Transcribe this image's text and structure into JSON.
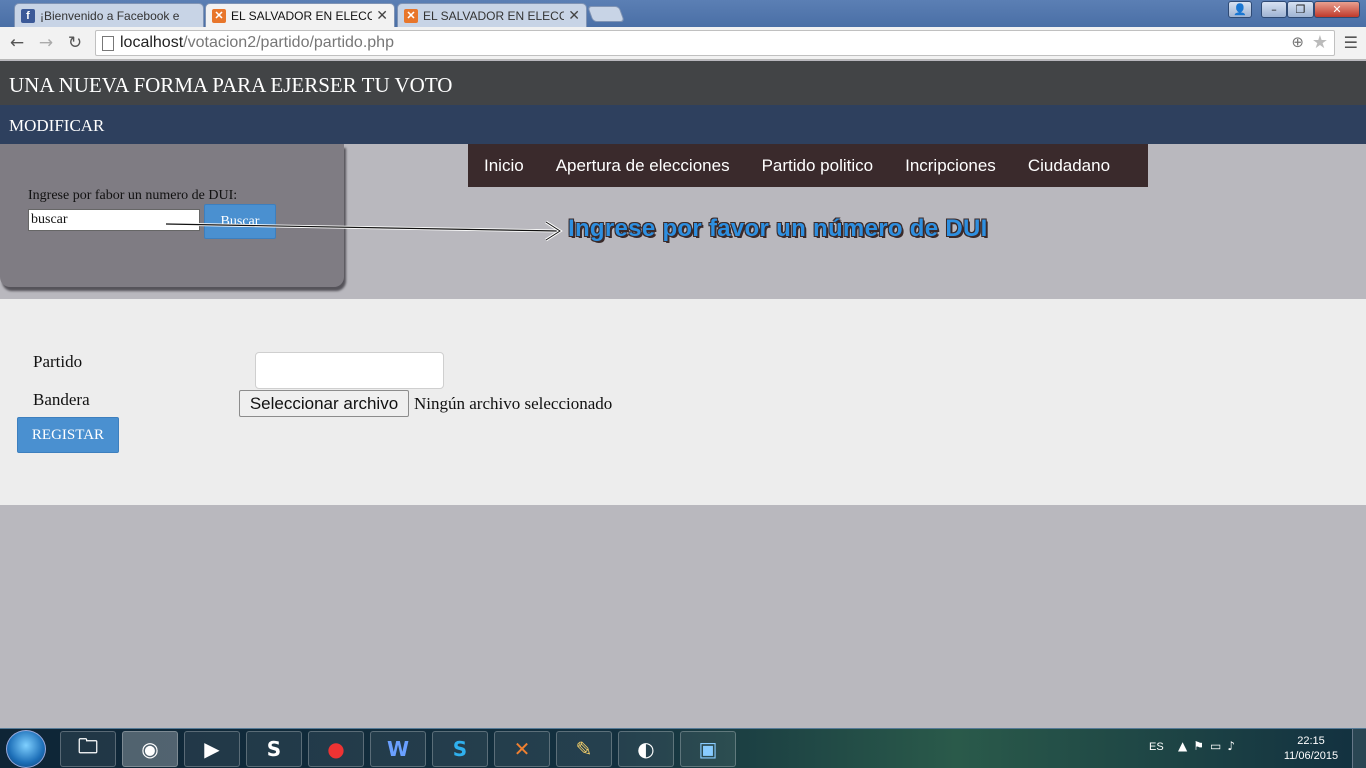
{
  "browser": {
    "tabs": [
      {
        "label": "¡Bienvenido a Facebook e",
        "favicon": "facebook-icon",
        "active": false
      },
      {
        "label": "EL SALVADOR EN ELECCIO",
        "favicon": "xampp-icon",
        "active": true
      },
      {
        "label": "EL SALVADOR EN ELECCIO",
        "favicon": "xampp-icon",
        "active": false
      }
    ],
    "url_host": "localhost",
    "url_path": "/votacion2/partido/partido.php"
  },
  "page": {
    "title": "UNA NUEVA FORMA PARA EJERSER TU VOTO",
    "subtitle": "MODIFICAR",
    "search": {
      "prompt": "Ingrese por fabor un numero de DUI:",
      "input_value": "buscar",
      "button_label": "Buscar"
    },
    "nav": [
      "Inicio",
      "Apertura de elecciones",
      "Partido politico",
      "Incripciones",
      "Ciudadano"
    ],
    "tooltip": "Ingrese por favor un número de DUI",
    "form": {
      "partido_label": "Partido",
      "bandera_label": "Bandera",
      "file_button_label": "Seleccionar archivo",
      "file_status": "Ningún archivo seleccionado",
      "submit_label": "REGISTAR"
    }
  },
  "taskbar": {
    "apps": [
      "file-explorer-icon",
      "chrome-icon",
      "media-player-icon",
      "sublime-text-icon",
      "claro-icon",
      "word-icon",
      "skype-icon",
      "xampp-icon",
      "paint-icon",
      "app-icon",
      "photo-viewer-icon"
    ],
    "language": "ES",
    "time": "22:15",
    "date": "11/06/2015"
  },
  "colors": {
    "header_dark": "#424446",
    "header_blue": "#2e405e",
    "nav_bg": "#3a2a2c",
    "button_blue": "#4a90d0",
    "tooltip_blue": "#2e8fe0"
  }
}
